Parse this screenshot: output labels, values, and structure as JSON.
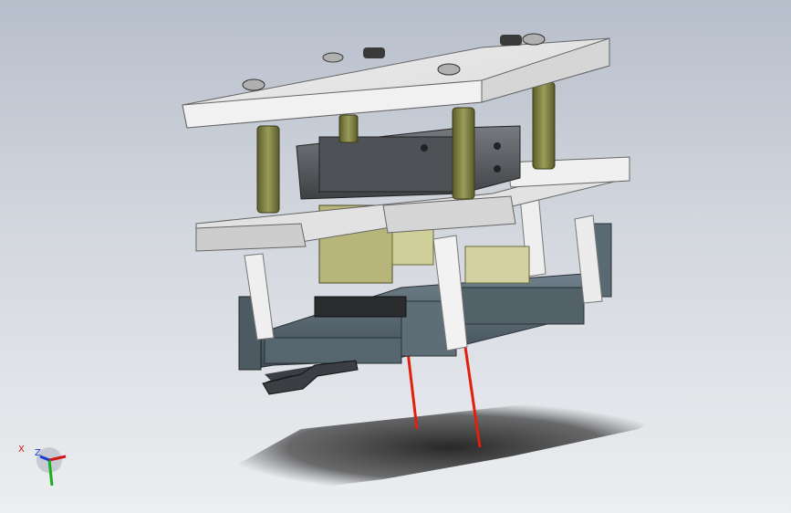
{
  "viewport": {
    "background_top": "#b7bfcc",
    "background_bottom": "#eceef0"
  },
  "colors": {
    "plate": "#e6e6e6",
    "plate_side": "#c4c4c4",
    "guide_post": "#7e8040",
    "cylinder_body": "#5f6266",
    "olive_part": "#b8b57a",
    "base_frame": "#5a6a72",
    "probe": "#e0200a",
    "shadow": "#2a2a2a"
  },
  "triad": {
    "x_label": "X",
    "z_label": "Z",
    "x_color": "#d01818",
    "y_color": "#18b018",
    "z_color": "#1a3ad0"
  }
}
